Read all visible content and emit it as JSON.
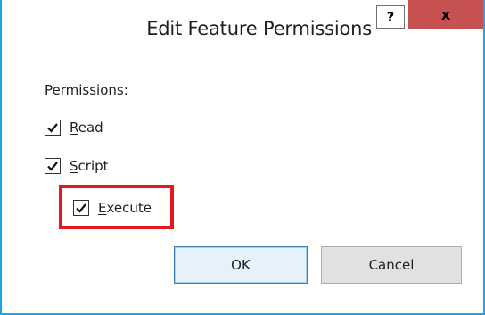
{
  "window": {
    "title": "Edit Feature Permissions",
    "help_label": "?",
    "close_label": "x"
  },
  "permissions": {
    "group_label": "Permissions:",
    "items": [
      {
        "accel": "R",
        "rest": "ead",
        "checked": true
      },
      {
        "accel": "S",
        "rest": "cript",
        "checked": true
      },
      {
        "accel": "E",
        "rest": "xecute",
        "checked": true
      }
    ]
  },
  "buttons": {
    "ok_label": "OK",
    "cancel_label": "Cancel"
  },
  "colors": {
    "accent_border": "#1ea4e9",
    "close_bg": "#c75050",
    "highlight": "#e5171f"
  }
}
